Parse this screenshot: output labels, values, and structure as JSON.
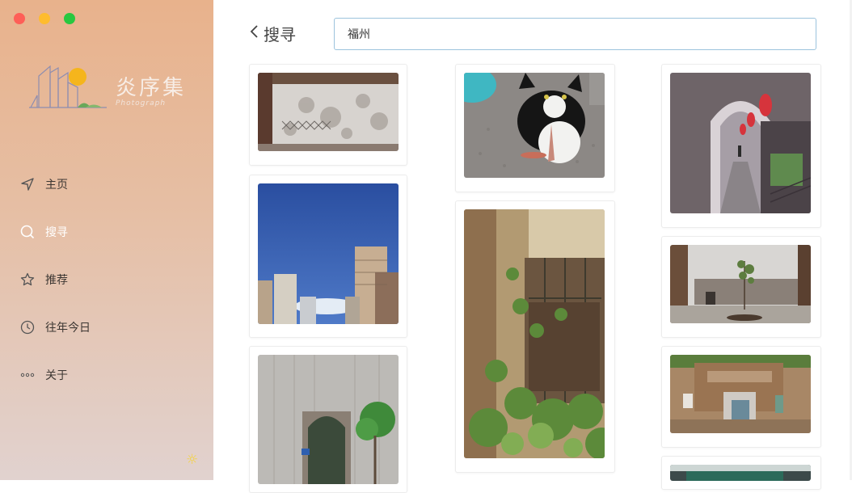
{
  "window": {
    "controls": [
      "close",
      "minimize",
      "maximize"
    ]
  },
  "logo": {
    "title": "炎序集",
    "subtitle": "Photograph"
  },
  "sidebar": {
    "items": [
      {
        "label": "主页",
        "icon": "navigation-arrow-icon"
      },
      {
        "label": "搜寻",
        "icon": "search-icon"
      },
      {
        "label": "推荐",
        "icon": "star-icon"
      },
      {
        "label": "往年今日",
        "icon": "clock-icon"
      },
      {
        "label": "关于",
        "icon": "more-dots-icon"
      }
    ],
    "theme_toggle_icon": "sun-icon"
  },
  "header": {
    "back_title": "搜寻"
  },
  "search": {
    "value": "福州"
  },
  "colors": {
    "accent_border": "#9cc3dd",
    "sidebar_top": "#e8b28c",
    "sidebar_bottom": "#e1d2cf"
  },
  "gallery": {
    "columns": [
      [
        "white wall with leaf shadows",
        "blue sky with tall buildings",
        "old wooden wall with arched doorway and tree"
      ],
      [
        "black and white cat",
        "old window with climbing vines"
      ],
      [
        "corridor with arches and red lanterns",
        "courtyard with small tree",
        "old brick gate",
        "building with green roof"
      ]
    ]
  }
}
